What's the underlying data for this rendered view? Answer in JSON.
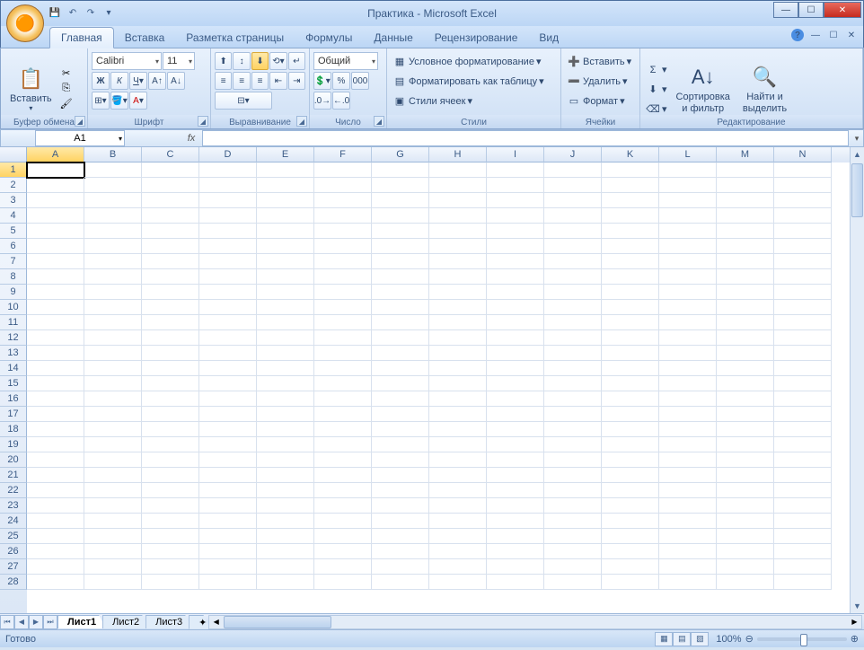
{
  "title": "Практика - Microsoft Excel",
  "qat": {
    "save": "💾"
  },
  "tabs": [
    "Главная",
    "Вставка",
    "Разметка страницы",
    "Формулы",
    "Данные",
    "Рецензирование",
    "Вид"
  ],
  "activeTab": 0,
  "ribbon": {
    "clipboard": {
      "label": "Буфер обмена",
      "paste": "Вставить"
    },
    "font": {
      "label": "Шрифт",
      "name": "Calibri",
      "size": "11"
    },
    "align": {
      "label": "Выравнивание"
    },
    "number": {
      "label": "Число",
      "format": "Общий"
    },
    "styles": {
      "label": "Стили",
      "cond": "Условное форматирование",
      "table": "Форматировать как таблицу",
      "cell": "Стили ячеек"
    },
    "cells": {
      "label": "Ячейки",
      "insert": "Вставить",
      "delete": "Удалить",
      "format": "Формат"
    },
    "editing": {
      "label": "Редактирование",
      "sort": "Сортировка\nи фильтр",
      "find": "Найти и\nвыделить"
    }
  },
  "namebox": "A1",
  "columns": [
    "A",
    "B",
    "C",
    "D",
    "E",
    "F",
    "G",
    "H",
    "I",
    "J",
    "K",
    "L",
    "M",
    "N"
  ],
  "rows": [
    "1",
    "2",
    "3",
    "4",
    "5",
    "6",
    "7",
    "8",
    "9",
    "10",
    "11",
    "12",
    "13",
    "14",
    "15",
    "16",
    "17",
    "18",
    "19",
    "20",
    "21",
    "22",
    "23",
    "24",
    "25",
    "26",
    "27",
    "28"
  ],
  "activeCell": {
    "row": 0,
    "col": 0
  },
  "sheets": [
    "Лист1",
    "Лист2",
    "Лист3"
  ],
  "activeSheet": 0,
  "status": "Готово",
  "zoom": "100%"
}
